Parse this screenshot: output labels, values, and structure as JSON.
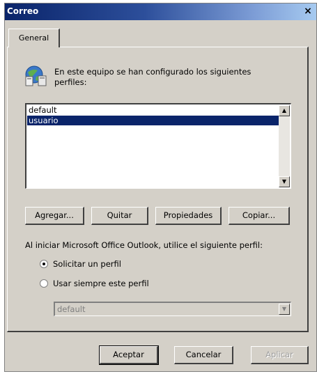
{
  "window": {
    "title": "Correo",
    "close_glyph": "×"
  },
  "tabs": [
    {
      "label": "General"
    }
  ],
  "intro": {
    "icon": "profiles-icon",
    "text": "En este equipo se han configurado los siguientes perfiles:"
  },
  "profiles": {
    "items": [
      {
        "label": "default",
        "selected": false
      },
      {
        "label": "usuario",
        "selected": true
      }
    ]
  },
  "profile_buttons": {
    "add": "Agregar...",
    "remove": "Quitar",
    "properties": "Propiedades",
    "copy": "Copiar..."
  },
  "startup": {
    "label": "Al iniciar Microsoft Office Outlook, utilice el siguiente perfil:",
    "options": [
      {
        "label": "Solicitar un perfil",
        "checked": true
      },
      {
        "label": "Usar siempre este perfil",
        "checked": false
      }
    ],
    "profile_select": {
      "value": "default",
      "disabled": true
    }
  },
  "footer": {
    "ok": "Aceptar",
    "cancel": "Cancelar",
    "apply": "Aplicar"
  }
}
